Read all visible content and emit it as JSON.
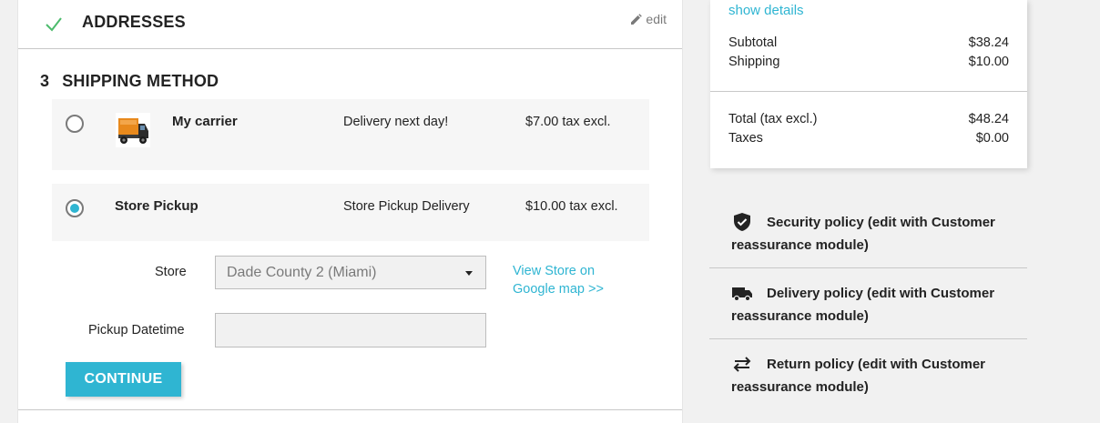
{
  "addresses_step": {
    "title": "ADDRESSES",
    "edit_label": "edit"
  },
  "shipping_step": {
    "number": "3",
    "title": "SHIPPING METHOD",
    "carriers": [
      {
        "name": "My carrier",
        "delay": "Delivery next day!",
        "price": "$7.00 tax excl.",
        "selected": false,
        "logo": "truck-logo"
      },
      {
        "name": "Store Pickup",
        "delay": "Store Pickup Delivery",
        "price": "$10.00 tax excl.",
        "selected": true
      }
    ],
    "store_label": "Store",
    "store_value": "Dade County 2 (Miami)",
    "store_link": "View Store on Google map >>",
    "pickup_label": "Pickup Datetime",
    "pickup_value": "",
    "continue_label": "CONTINUE"
  },
  "summary": {
    "show_details": "show details",
    "subtotal_label": "Subtotal",
    "subtotal_value": "$38.24",
    "shipping_label": "Shipping",
    "shipping_value": "$10.00",
    "total_label": "Total (tax excl.)",
    "total_value": "$48.24",
    "taxes_label": "Taxes",
    "taxes_value": "$0.00"
  },
  "reassurance": [
    {
      "icon": "shield-icon",
      "text": "Security policy (edit with Customer reassurance module)"
    },
    {
      "icon": "truck-icon",
      "text": "Delivery policy (edit with Customer reassurance module)"
    },
    {
      "icon": "swap-arrows-icon",
      "text": "Return policy (edit with Customer reassurance module)"
    }
  ],
  "colors": {
    "accent": "#2fb5d2",
    "check": "#4cbb6c",
    "text": "#232323"
  }
}
